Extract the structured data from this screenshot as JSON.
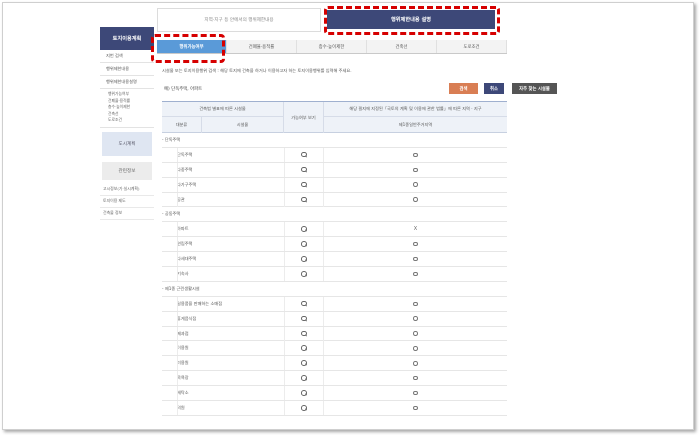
{
  "sidebar": {
    "title": "토지이용계획",
    "items": [
      "지번 검색",
      "행위제한내용",
      "행위제한내용설명"
    ],
    "subitems": [
      "행위가능여부",
      "건폐율·용적률",
      "층수·높이제한",
      "건축선",
      "도로조건"
    ],
    "block1": "도시계획",
    "block2": "관련정보",
    "links": [
      "고시정보(기·실시계획)",
      "토지이용 제도",
      "건축물 정보"
    ]
  },
  "topbar": {
    "left_label": "지역·지구 등 안에서의 행위제한내용",
    "right_label": "행위제한내용 설명"
  },
  "tabs": [
    {
      "label": "행위가능여부",
      "active": true
    },
    {
      "label": "건폐율·용적률",
      "active": false
    },
    {
      "label": "층수·높이제한",
      "active": false
    },
    {
      "label": "건축선",
      "active": false
    },
    {
      "label": "도로조건",
      "active": false
    }
  ],
  "description": "시설물 또는 토지이용행위 검색 : 해당 토지에 건축을 하거나 이용하고자 하는 토지이용행위를 입력해 주세요.",
  "search": {
    "value": "예) 단독주택, 아파트"
  },
  "buttons": {
    "search": "검색",
    "cancel": "취소",
    "often": "자주 찾는 시설물"
  },
  "table": {
    "header_group": "건축법 별표에 따른 시설물",
    "col_category": "대분류",
    "col_facility": "시설물",
    "col_possible": "가능여부 보기",
    "col_law": "해당 필지에 지정된「국토의 계획 및 이용에 관한 법률」에 따른 지역 · 지구",
    "col_zone": "제1종일반주거지역",
    "rows": [
      {
        "type": "cat",
        "name": "- 단독주택"
      },
      {
        "type": "item",
        "name": "단독주택",
        "value": "○"
      },
      {
        "type": "item",
        "name": "다중주택",
        "value": "○"
      },
      {
        "type": "item",
        "name": "다가구주택",
        "value": "○"
      },
      {
        "type": "item",
        "name": "공관",
        "value": "○"
      },
      {
        "type": "cat",
        "name": "- 공동주택"
      },
      {
        "type": "item",
        "name": "아파트",
        "value": "X"
      },
      {
        "type": "item",
        "name": "연립주택",
        "value": "○"
      },
      {
        "type": "item",
        "name": "다세대주택",
        "value": "○"
      },
      {
        "type": "item",
        "name": "기숙사",
        "value": "○"
      },
      {
        "type": "cat",
        "name": "- 제1종 근린생활시설"
      },
      {
        "type": "item",
        "name": "일용품을 판매하는 소매점",
        "value": "○"
      },
      {
        "type": "item",
        "name": "휴게음식점",
        "value": "○"
      },
      {
        "type": "item",
        "name": "제과점",
        "value": "○"
      },
      {
        "type": "item",
        "name": "이용원",
        "value": "○"
      },
      {
        "type": "item",
        "name": "미용원",
        "value": "○"
      },
      {
        "type": "item",
        "name": "목욕장",
        "value": "○"
      },
      {
        "type": "item",
        "name": "세탁소",
        "value": "○"
      },
      {
        "type": "item",
        "name": "의원",
        "value": "○"
      }
    ]
  },
  "colors": {
    "navy": "#3d4878",
    "tab_active": "#5a9ad8",
    "search_btn": "#d97e54",
    "highlight": "#d60000"
  }
}
